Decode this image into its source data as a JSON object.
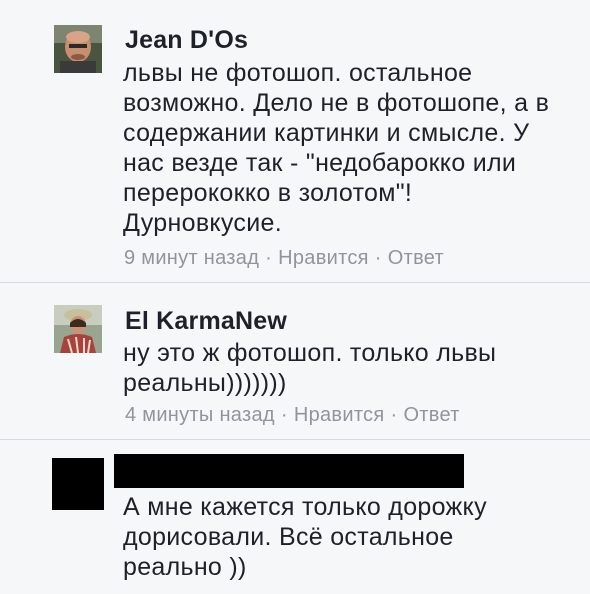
{
  "comments": [
    {
      "author": "Jean D'Os",
      "text_lines": [
        "львы не фотошоп. остальное",
        "возможно. Дело не в фотошопе, а в",
        "содержании картинки и смысле. У",
        "нас везде так - \"недобарокко или",
        "перерококко в золотом\"!",
        "Дурновкусие."
      ],
      "time": "9 минут назад",
      "like": "Нравится",
      "reply": "Ответ"
    },
    {
      "author": "El KarmaNew",
      "text_lines": [
        "ну это ж фотошоп. только львы",
        "реальны)))))))"
      ],
      "time": "4 минуты назад",
      "like": "Нравится",
      "reply": "Ответ"
    },
    {
      "author": "",
      "text_lines": [
        "А мне кажется только дорожку",
        "дорисовали. Всё остальное",
        "реально ))"
      ]
    }
  ],
  "separator": "·",
  "colors": {
    "background": "#f6f7f9",
    "text": "#1d2129",
    "meta": "#90949c",
    "divider": "#d7dae0",
    "redaction": "#000000"
  }
}
